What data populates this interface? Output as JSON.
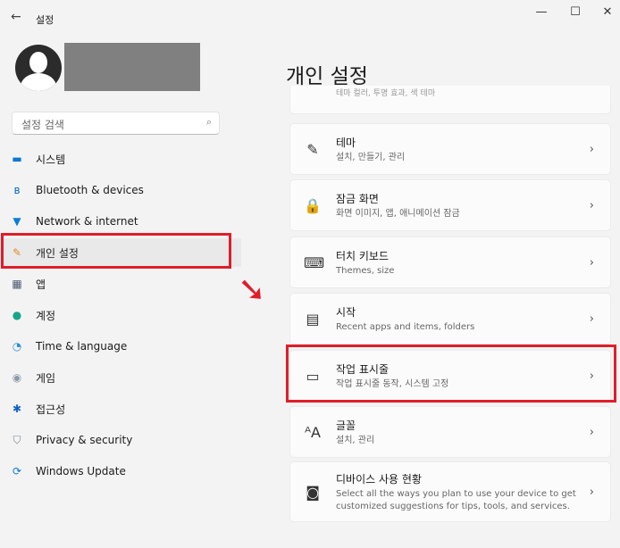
{
  "window": {
    "title": "설정",
    "back_icon": "←",
    "minimize": "—",
    "maximize": "☐",
    "close": "✕"
  },
  "search": {
    "placeholder": "설정 검색",
    "icon": "⌕"
  },
  "sidebar": {
    "items": [
      {
        "label": "시스템",
        "icon": "▬",
        "color": "#0078d4"
      },
      {
        "label": "Bluetooth & devices",
        "icon": "ʙ",
        "color": "#0067c0"
      },
      {
        "label": "Network & internet",
        "icon": "▼",
        "color": "#0a7cd9"
      },
      {
        "label": "개인 설정",
        "icon": "✎",
        "color": "#e08a2b"
      },
      {
        "label": "앱",
        "icon": "▦",
        "color": "#4a5b70"
      },
      {
        "label": "계정",
        "icon": "●",
        "color": "#17a589"
      },
      {
        "label": "Time & language",
        "icon": "◔",
        "color": "#2a8fd6"
      },
      {
        "label": "게임",
        "icon": "◉",
        "color": "#8a9aa8"
      },
      {
        "label": "접근성",
        "icon": "✱",
        "color": "#0f62c8"
      },
      {
        "label": "Privacy & security",
        "icon": "⛉",
        "color": "#7a8690"
      },
      {
        "label": "Windows Update",
        "icon": "⟳",
        "color": "#0a78d4"
      }
    ]
  },
  "main": {
    "title": "개인 설정",
    "partial_card_subtitle": "테마 컬러, 투명 효과, 색 테마",
    "cards": [
      {
        "title": "테마",
        "subtitle": "설치, 만들기, 관리",
        "icon": "✎"
      },
      {
        "title": "잠금 화면",
        "subtitle": "화면 이미지, 앱, 애니메이션 잠금",
        "icon": "🔒"
      },
      {
        "title": "터치 키보드",
        "subtitle": "Themes, size",
        "icon": "⌨"
      },
      {
        "title": "시작",
        "subtitle": "Recent apps and items, folders",
        "icon": "▤"
      },
      {
        "title": "작업 표시줄",
        "subtitle": "작업 표시줄 동작, 시스템 고정",
        "icon": "▭"
      },
      {
        "title": "글꼴",
        "subtitle": "설치, 관리",
        "icon": "ᴬA"
      },
      {
        "title": "디바이스 사용 현황",
        "subtitle": "Select all the ways you plan to use your device to get customized suggestions for tips, tools, and services.",
        "icon": "◙"
      }
    ],
    "chevron": "›"
  },
  "annotation": {
    "arrow": "➘",
    "color": "#e11d2a"
  }
}
